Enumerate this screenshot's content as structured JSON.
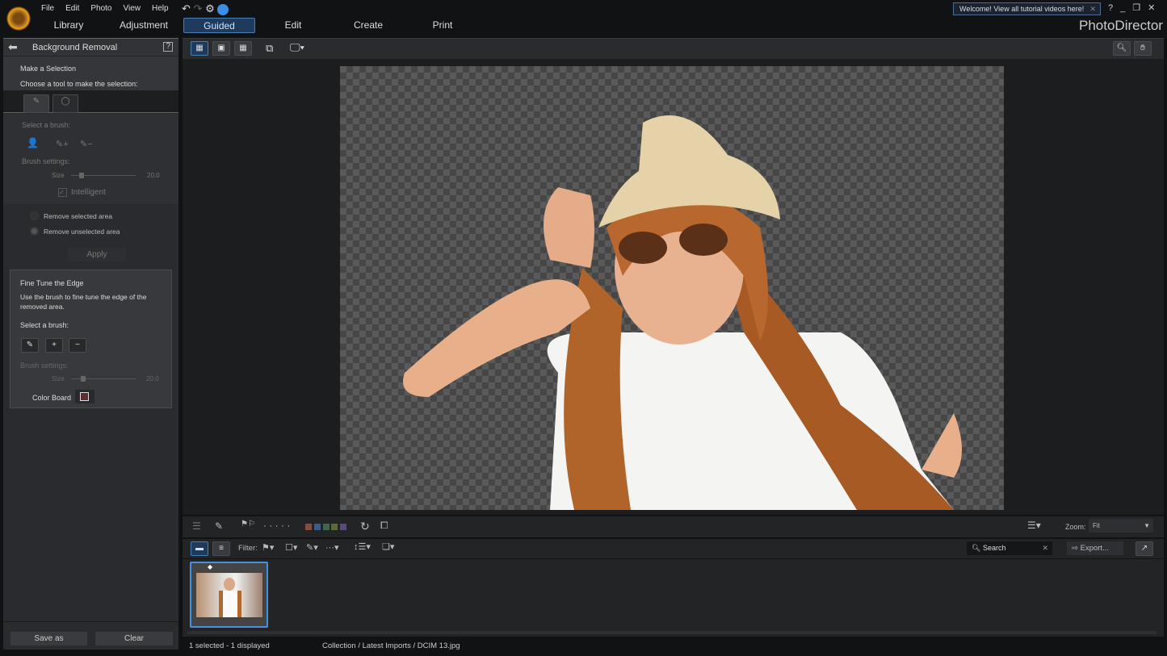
{
  "app": {
    "title": "PhotoDirector",
    "menu": [
      "File",
      "Edit",
      "Photo",
      "View",
      "Help"
    ],
    "tabs": [
      "Library",
      "Adjustment",
      "Guided",
      "Edit",
      "Create",
      "Print"
    ],
    "active_tab": "Guided",
    "welcome": "Welcome! View all tutorial videos here!"
  },
  "panel": {
    "title": "Background Removal",
    "selection_heading": "Make a Selection",
    "selection_hint": "Choose a tool to make the selection:",
    "select_brush": "Select a brush:",
    "brush_settings": "Brush settings:",
    "size_label": "Size",
    "size_value": "20.0",
    "intelligent": "Intelligent",
    "remove_selected": "Remove selected area",
    "remove_unselected": "Remove unselected area",
    "apply": "Apply",
    "fine_tune": {
      "heading": "Fine Tune the Edge",
      "hint": "Use the brush to fine tune the edge of the removed area.",
      "select_brush": "Select a brush:",
      "brush_settings": "Brush settings:",
      "size_label": "Size",
      "size_value": "20.0",
      "color_board": "Color Board"
    },
    "save_as": "Save as",
    "clear": "Clear"
  },
  "browser": {
    "zoom_label": "Zoom:",
    "zoom_value": "Fit",
    "filter_label": "Filter:",
    "search_placeholder": "Search",
    "export": "Export...",
    "status": "1 selected - 1 displayed",
    "path": "Collection / Latest Imports / DCIM 13.jpg"
  },
  "colors": {
    "accent": "#4a90d9",
    "label_colors": [
      "#8a4a44",
      "#3d5a8a",
      "#3f6a4a",
      "#5c6a3a",
      "#5a4a7a"
    ]
  }
}
